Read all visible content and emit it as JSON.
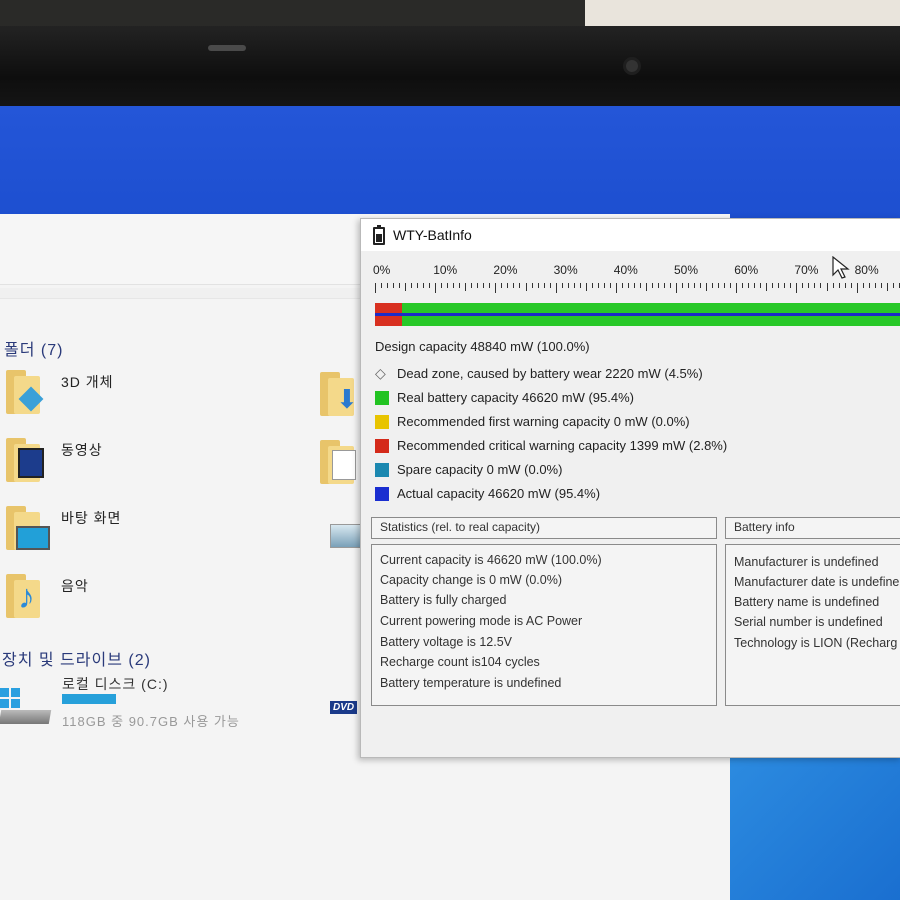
{
  "explorer": {
    "folders_heading": "폴더 (7)",
    "folders": [
      {
        "label": "3D 개체",
        "icon": "3d-objects-folder-icon"
      },
      {
        "label": "동영상",
        "icon": "videos-folder-icon"
      },
      {
        "label": "바탕 화면",
        "icon": "desktop-folder-icon"
      },
      {
        "label": "음악",
        "icon": "music-folder-icon"
      }
    ],
    "devices_heading": "장치 및 드라이브 (2)",
    "drive": {
      "label": "로컬 디스크 (C:)",
      "usage_text": "118GB 중 90.7GB 사용 가능",
      "used_fraction": 0.23
    },
    "dvd_badge": "DVD"
  },
  "batinfo": {
    "title": "WTY-BatInfo",
    "scale_labels": [
      "0%",
      "10%",
      "20%",
      "30%",
      "40%",
      "50%",
      "60%",
      "70%",
      "80%"
    ],
    "dead_zone_fraction": 0.045,
    "legend": [
      {
        "text": "Design capacity 48840 mW (100.0%)",
        "swatch": null
      },
      {
        "text": "Dead zone, caused by battery wear 2220 mW (4.5%)",
        "swatch": "dead"
      },
      {
        "text": "Real battery capacity 46620 mW (95.4%)",
        "swatch": "#22c322"
      },
      {
        "text": "Recommended first warning capacity 0 mW (0.0%)",
        "swatch": "#e8c400"
      },
      {
        "text": "Recommended critical warning capacity 1399 mW (2.8%)",
        "swatch": "#d42a1a"
      },
      {
        "text": "Spare capacity  0 mW (0.0%)",
        "swatch": "#1c88b0"
      },
      {
        "text": "Actual capacity 46620 mW (95.4%)",
        "swatch": "#1a2ed0"
      }
    ],
    "statistics": {
      "heading": "Statistics (rel. to real capacity)",
      "lines": [
        "Current capacity is 46620 mW (100.0%)",
        "Capacity change is 0 mW (0.0%)",
        "Battery is fully charged",
        "Current powering mode is AC Power",
        "Battery voltage is 12.5V",
        "Recharge count is104 cycles",
        "Battery temperature is undefined"
      ]
    },
    "battery_info": {
      "heading": "Battery info",
      "lines": [
        "Manufacturer is undefined",
        "Manufacturer date is undefine",
        "Battery name is undefined",
        "Serial number is undefined",
        "Technology is LION (Recharg"
      ]
    }
  }
}
